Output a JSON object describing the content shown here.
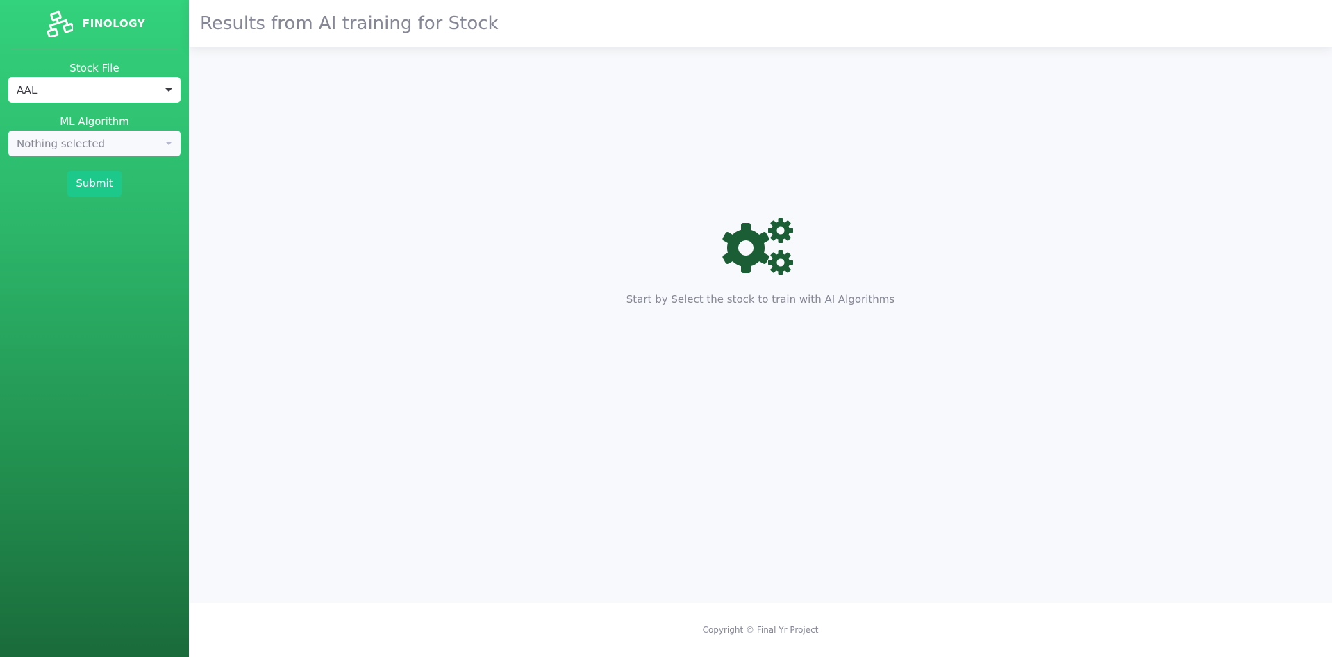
{
  "sidebar": {
    "brand": {
      "name": "FINOLOGY",
      "icon": "sitemap-icon"
    },
    "stock_field": {
      "label": "Stock File",
      "selected": "AAL"
    },
    "algorithm_field": {
      "label": "ML Algorithm",
      "placeholder": "Nothing selected"
    },
    "submit_label": "Submit"
  },
  "header": {
    "title": "Results from AI training for Stock"
  },
  "main": {
    "empty_state": {
      "icon": "gears-icon",
      "message": "Start by Select the stock to train with AI Algorithms"
    }
  },
  "footer": {
    "copyright": "Copyright © Final Yr Project"
  },
  "colors": {
    "sidebar_gradient_top": "#33d27c",
    "sidebar_gradient_bottom": "#1a6b3a",
    "submit_button": "#1cc88a",
    "icon_dark_green": "#1b5e35",
    "muted_text": "#858796",
    "page_background": "#f8f9fc"
  }
}
